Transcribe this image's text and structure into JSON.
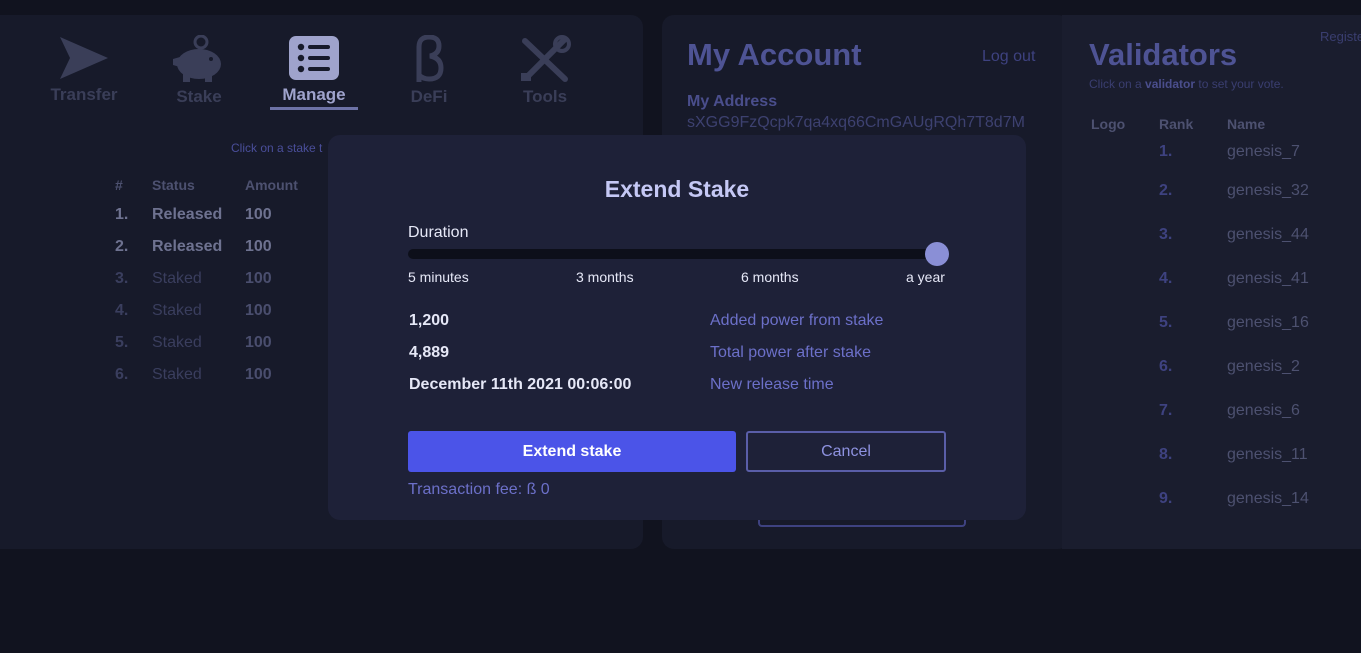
{
  "nav": {
    "items": [
      {
        "label": "Transfer",
        "icon": "send-icon"
      },
      {
        "label": "Stake",
        "icon": "piggy-bank-icon"
      },
      {
        "label": "Manage",
        "icon": "list-icon",
        "active": true
      },
      {
        "label": "DeFi",
        "icon": "beta-icon"
      },
      {
        "label": "Tools",
        "icon": "tools-icon"
      }
    ]
  },
  "manage": {
    "hint": "Click on a stake t",
    "columns": [
      "#",
      "Status",
      "Amount"
    ],
    "rows": [
      {
        "n": "1.",
        "status": "Released",
        "amount": "100"
      },
      {
        "n": "2.",
        "status": "Released",
        "amount": "100"
      },
      {
        "n": "3.",
        "status": "Staked",
        "amount": "100"
      },
      {
        "n": "4.",
        "status": "Staked",
        "amount": "100"
      },
      {
        "n": "5.",
        "status": "Staked",
        "amount": "100"
      },
      {
        "n": "6.",
        "status": "Staked",
        "amount": "100"
      }
    ]
  },
  "account": {
    "title": "My Account",
    "logout": "Log out",
    "address_label": "My Address",
    "address": "sXGG9FzQcpk7qa4xq66CmGAUgRQh7T8d7M"
  },
  "validators": {
    "title": "Validators",
    "subtitle_pre": "Click on a",
    "subtitle_bold": "validator",
    "subtitle_post": "to set your vote.",
    "register": "Registe",
    "columns": {
      "logo": "Logo",
      "rank": "Rank",
      "name": "Name"
    },
    "rows": [
      {
        "rank": "1.",
        "name": "genesis_7"
      },
      {
        "rank": "2.",
        "name": "genesis_32"
      },
      {
        "rank": "3.",
        "name": "genesis_44"
      },
      {
        "rank": "4.",
        "name": "genesis_41"
      },
      {
        "rank": "5.",
        "name": "genesis_16"
      },
      {
        "rank": "6.",
        "name": "genesis_2"
      },
      {
        "rank": "7.",
        "name": "genesis_6"
      },
      {
        "rank": "8.",
        "name": "genesis_11"
      },
      {
        "rank": "9.",
        "name": "genesis_14"
      }
    ]
  },
  "modal": {
    "title": "Extend Stake",
    "duration_label": "Duration",
    "slider_value": 1.0,
    "ticks": [
      "5 minutes",
      "3 months",
      "6 months",
      "a year"
    ],
    "stats": [
      {
        "value": "1,200",
        "label": "Added power from stake"
      },
      {
        "value": "4,889",
        "label": "Total power after stake"
      },
      {
        "value": "December 11th 2021 00:06:00",
        "label": "New release time"
      }
    ],
    "confirm_label": "Extend stake",
    "cancel_label": "Cancel",
    "fee": "Transaction fee: ß 0"
  },
  "colors": {
    "accent": "#4b54e8",
    "thumb": "#8a8fd6",
    "muted_link": "#6c70c9"
  }
}
